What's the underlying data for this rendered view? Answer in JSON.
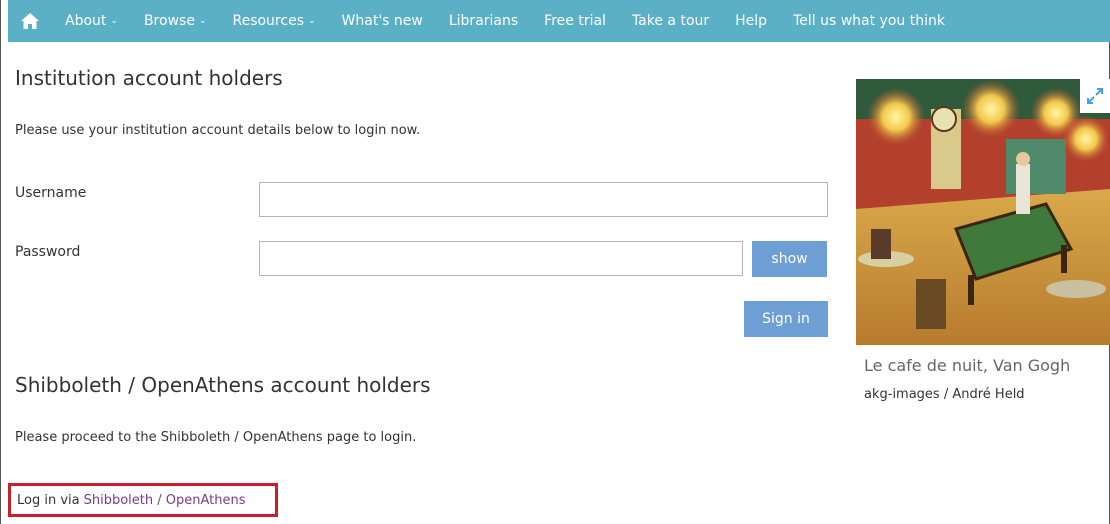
{
  "nav": {
    "items": [
      {
        "label": "About",
        "caret": true
      },
      {
        "label": "Browse",
        "caret": true
      },
      {
        "label": "Resources",
        "caret": true
      },
      {
        "label": "What's new",
        "caret": false
      },
      {
        "label": "Librarians",
        "caret": false
      },
      {
        "label": "Free trial",
        "caret": false
      },
      {
        "label": "Take a tour",
        "caret": false
      },
      {
        "label": "Help",
        "caret": false
      },
      {
        "label": "Tell us what you think",
        "caret": false
      }
    ],
    "caret_glyph": "⌄",
    "home_icon": "home-icon"
  },
  "institution": {
    "title": "Institution account holders",
    "intro": "Please use your institution account details below to login now.",
    "username_label": "Username",
    "username_value": "",
    "password_label": "Password",
    "password_value": "",
    "show_label": "show",
    "signin_label": "Sign in"
  },
  "shibboleth": {
    "title": "Shibboleth / OpenAthens account holders",
    "intro": "Please proceed to the Shibboleth / OpenAthens page to login.",
    "login_prefix": "Log in via",
    "login_link": "Shibboleth / OpenAthens"
  },
  "artwork": {
    "caption": "Le cafe de nuit, Van Gogh",
    "credit": "akg-images / André Held",
    "expand_icon": "expand-icon"
  },
  "colors": {
    "nav_bg": "#5bb0c5",
    "button": "#6e9fd4",
    "link": "#7a3a8a",
    "highlight": "#c8202a"
  }
}
